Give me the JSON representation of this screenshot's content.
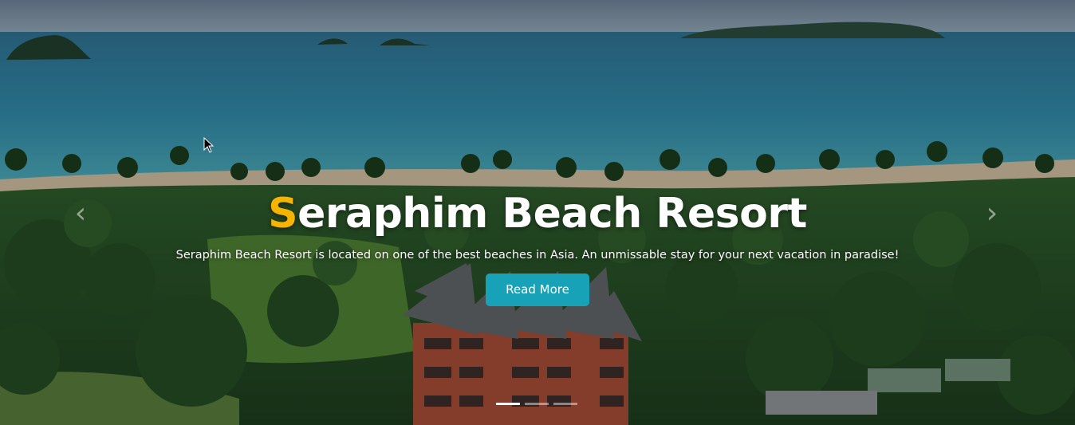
{
  "hero": {
    "title_initial": "S",
    "title_rest": "eraphim Beach Resort",
    "subtitle": "Seraphim Beach Resort is located on one of the best beaches in Asia. An unmissable stay for your next vacation in paradise!",
    "button_label": "Read More",
    "prev_glyph": "‹",
    "next_glyph": "›"
  },
  "carousel": {
    "slide_count": 3,
    "active_index": 0
  },
  "icons": {
    "prev": "chevron-left-icon",
    "next": "chevron-right-icon",
    "cursor": "mouse-pointer-icon"
  },
  "colors": {
    "accent": "#f4b400",
    "button": "#17a2b8",
    "text": "#ffffff"
  }
}
